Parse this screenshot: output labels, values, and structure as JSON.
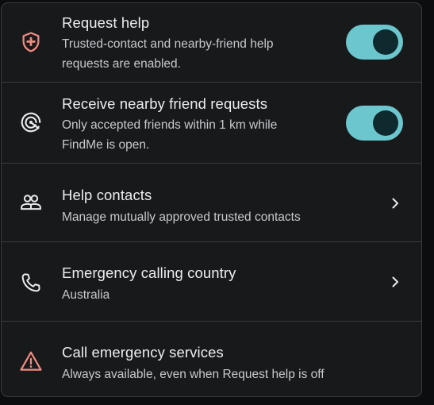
{
  "colors": {
    "accent": "#6cc6cd",
    "danger_icon": "#f28b82",
    "card_bg": "#17191b",
    "divider": "#3a3d40"
  },
  "settings": [
    {
      "title": "Request help",
      "subtitle_lines": [
        "Trusted-contact and nearby-friend help",
        "requests are enabled."
      ],
      "icon": "shield-plus-icon",
      "control": "toggle",
      "enabled": true
    },
    {
      "title": "Receive nearby friend requests",
      "subtitle_lines": [
        "Only accepted friends within 1 km while",
        "FindMe is open."
      ],
      "icon": "nearby-radar-icon",
      "control": "toggle",
      "enabled": true
    },
    {
      "title": "Help contacts",
      "subtitle_lines": [
        "Manage mutually approved trusted contacts"
      ],
      "icon": "people-icon",
      "control": "chevron"
    },
    {
      "title": "Emergency calling country",
      "subtitle_lines": [
        "Australia"
      ],
      "icon": "phone-icon",
      "control": "chevron"
    },
    {
      "title": "Call emergency services",
      "subtitle_lines": [
        "Always available, even when Request help is off"
      ],
      "icon": "warning-triangle-icon",
      "control": "none"
    }
  ]
}
